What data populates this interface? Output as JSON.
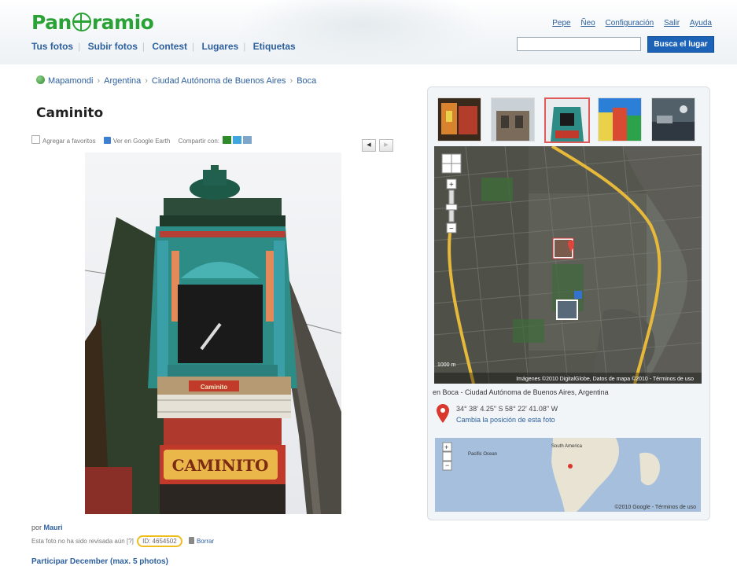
{
  "header": {
    "brand": "Pan⊕ramio",
    "logo_text_pre": "Pan",
    "logo_text_post": "ramio",
    "nav": [
      {
        "label": "Tus fotos"
      },
      {
        "label": "Subir fotos"
      },
      {
        "label": "Contest"
      },
      {
        "label": "Lugares"
      },
      {
        "label": "Etiquetas"
      }
    ],
    "top_links": [
      {
        "label": "Pepe"
      },
      {
        "label": "Ñeo"
      },
      {
        "label": "Configuración"
      },
      {
        "label": "Salir"
      },
      {
        "label": "Ayuda"
      }
    ],
    "search": {
      "value": "",
      "button_label": "Busca el lugar"
    }
  },
  "breadcrumb": [
    "Mapamondi",
    "Argentina",
    "Ciudad Autónoma de Buenos Aires",
    "Boca"
  ],
  "photo": {
    "title": "Caminito",
    "actions": {
      "favorite": "Agregar a favoritos",
      "google_earth": "Ver en Google Earth",
      "share": "Compartir con:"
    },
    "sign_text": "CAMINITO",
    "author_prefix": "por",
    "author": "Mauri",
    "info_text": "Esta foto no ha sido revisada aún [?]",
    "photo_id": "ID: 4654502",
    "delete_label": "Borrar",
    "participate": "Participar December (max. 5 photos)"
  },
  "sidebar": {
    "location": "en Boca - Ciudad Autónoma de Buenos Aires, Argentina",
    "coords": "34° 38' 4.25\" S  58° 22' 41.08\" W",
    "change_position": "Cambia la posición de esta foto",
    "map_attribution": "Imágenes ©2010 DigitalGlobe, Datos de mapa ©2010 - Términos de uso",
    "map_scale": "1000 m",
    "overview_attribution": "©2010 Google - Términos de uso",
    "overview_label_sa": "South America",
    "overview_label_ocean": "Pacific Ocean"
  },
  "colors": {
    "brand_green": "#2aa236",
    "link_blue": "#2c5f9e",
    "button_blue": "#1c63b8",
    "highlight_yellow": "#f0bd1e",
    "selected_red": "#e05a5a"
  }
}
